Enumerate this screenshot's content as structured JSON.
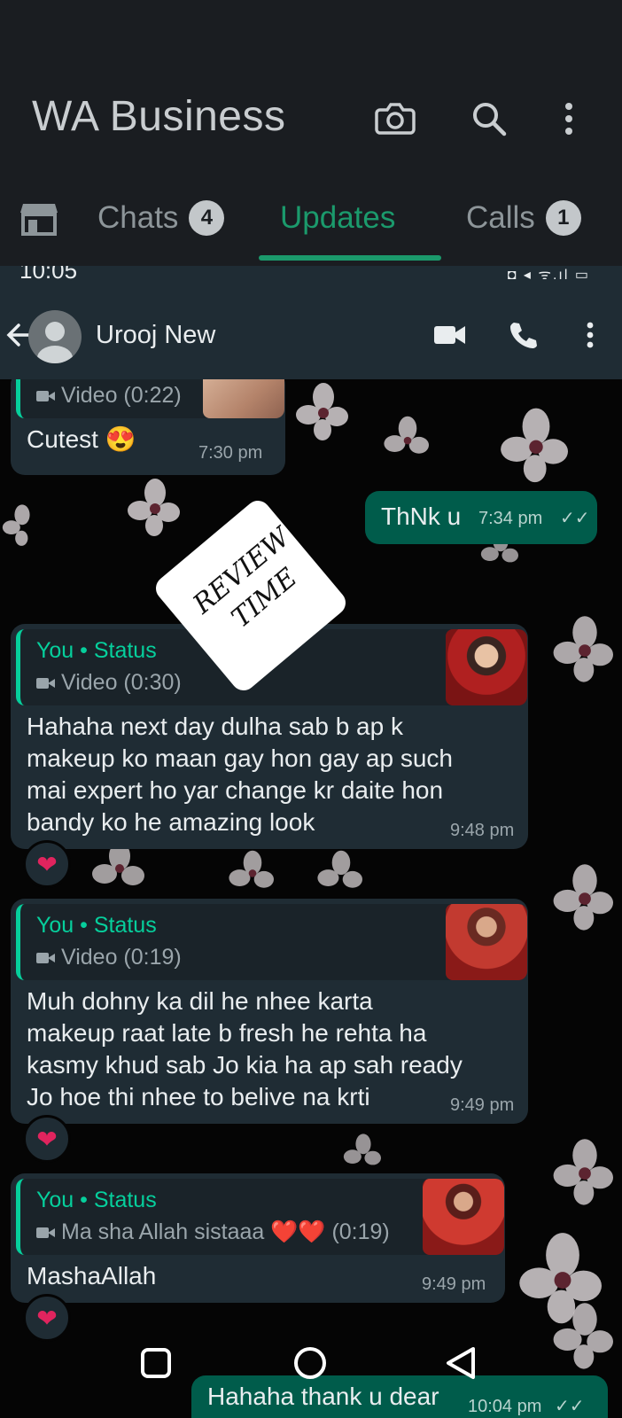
{
  "app": {
    "title": "WA Business"
  },
  "header_icons": {
    "camera": "camera-icon",
    "search": "search-icon",
    "menu": "more-vert-icon"
  },
  "tabs": [
    {
      "label": "Chats",
      "badge": "4",
      "active": false
    },
    {
      "label": "Updates",
      "badge": "",
      "active": true
    },
    {
      "label": "Calls",
      "badge": "1",
      "active": false
    }
  ],
  "status_bar": {
    "time": "10:05",
    "icons_right": "◘ ◂ ᯤ.ıl ▭"
  },
  "chat": {
    "contact_name": "Urooj New"
  },
  "messages": [
    {
      "id": "m1",
      "direction": "in",
      "quote_sub": "Video (0:22)",
      "text": [
        "Cutest 😍"
      ],
      "time": "7:30 pm"
    },
    {
      "id": "m2",
      "direction": "out",
      "text": [
        "ThNk u"
      ],
      "time": "7:34 pm",
      "ticks": "✓✓"
    },
    {
      "id": "m3",
      "direction": "in",
      "quote_title": "You • Status",
      "quote_sub": "Video (0:30)",
      "text": [
        "Hahaha next day dulha sab b ap k",
        "makeup ko maan  gay hon gay ap such",
        "mai expert  ho yar change kr daite  hon",
        "bandy  ko he amazing look"
      ],
      "time": "9:48 pm",
      "reaction": "❤"
    },
    {
      "id": "m4",
      "direction": "in",
      "quote_title": "You • Status",
      "quote_sub": "Video (0:19)",
      "text": [
        "Muh  dohny  ka dil  he nhee karta",
        "makeup  raat late  b fresh  he rehta  ha",
        "kasmy khud  sab Jo kia ha ap sah ready",
        "Jo hoe thi nhee  to belive  na krti"
      ],
      "time": "9:49 pm",
      "reaction": "❤"
    },
    {
      "id": "m5",
      "direction": "in",
      "quote_title": "You • Status",
      "quote_sub": "Ma sha Allah sistaaa ❤️❤️ (0:19)",
      "text": [
        "MashaAllah"
      ],
      "time": "9:49 pm",
      "reaction": "❤"
    },
    {
      "id": "m6",
      "direction": "out",
      "text": [
        "Hahaha thank u dear"
      ],
      "time": "10:04 pm",
      "ticks": "✓✓"
    }
  ],
  "sticker": {
    "line1": "REVIEW",
    "line2": "TIME"
  },
  "colors": {
    "accent": "#1b9a6c",
    "incoming": "#1f2c34",
    "outgoing": "#005c4b",
    "quote_accent": "#06cf9c"
  }
}
